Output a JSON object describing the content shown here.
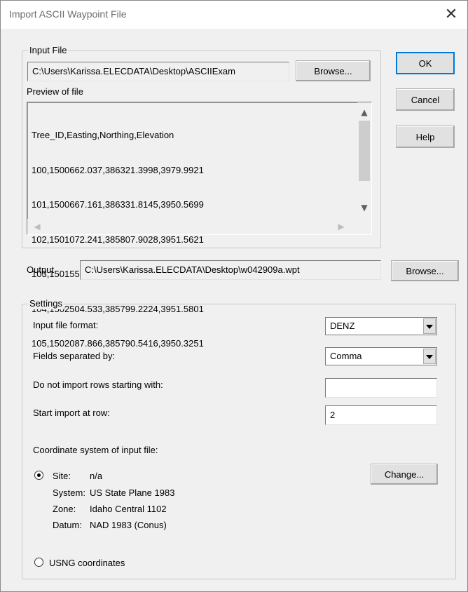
{
  "window": {
    "title": "Import ASCII Waypoint File",
    "close_glyph": "✕"
  },
  "input_file": {
    "group_label": "Input File",
    "path": "C:\\Users\\Karissa.ELECDATA\\Desktop\\ASCIIExam",
    "browse_label": "Browse...",
    "preview_label": "Preview of file",
    "preview_lines": [
      "Tree_ID,Easting,Northing,Elevation",
      "100,1500662.037,386321.3998,3979.9921",
      "101,1500667.161,386331.8145,3950.5699",
      "102,1501072.241,385807.9028,3951.5621",
      "103,1501558.353,385790.5416,3950.5689",
      "104,1502504.533,385799.2224,3951.5801",
      "105,1502087.866,385790.5416,3950.3251"
    ]
  },
  "buttons": {
    "ok": "OK",
    "cancel": "Cancel",
    "help": "Help"
  },
  "output": {
    "label": "Output",
    "path": "C:\\Users\\Karissa.ELECDATA\\Desktop\\w042909a.wpt",
    "browse_label": "Browse..."
  },
  "settings": {
    "group_label": "Settings",
    "input_format_label": "Input file format:",
    "input_format_value": "DENZ",
    "separator_label": "Fields separated by:",
    "separator_value": "Comma",
    "skip_rows_label": "Do not import rows starting with:",
    "skip_rows_value": "",
    "start_row_label": "Start import at row:",
    "start_row_value": "2",
    "coord_system_label": "Coordinate system of input file:",
    "site_label": "Site:",
    "site_value": "n/a",
    "system_label": "System:",
    "system_value": "US State Plane 1983",
    "zone_label": "Zone:",
    "zone_value": "Idaho Central 1102",
    "datum_label": "Datum:",
    "datum_value": "NAD 1983 (Conus)",
    "change_label": "Change...",
    "usng_label": "USNG coordinates",
    "selected_option": "site"
  }
}
